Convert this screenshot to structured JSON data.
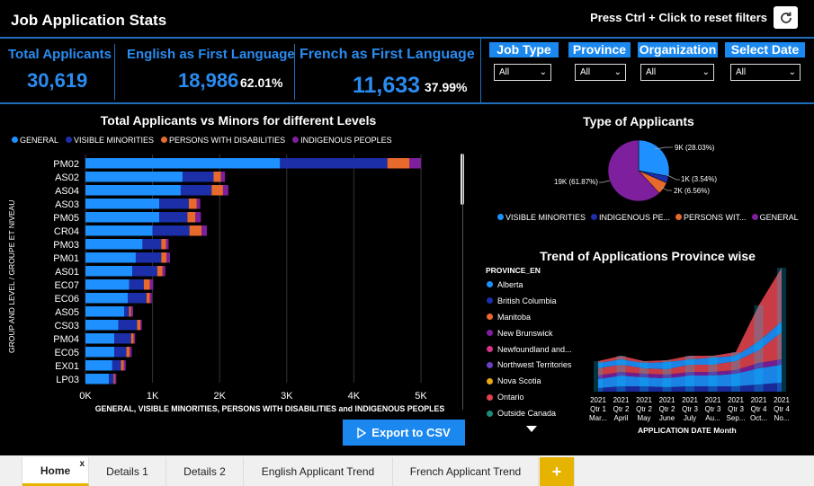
{
  "header": {
    "title": "Job Application Stats",
    "reset_hint": "Press Ctrl + Click to reset filters"
  },
  "kpis": {
    "total": {
      "title": "Total Applicants",
      "value": "30,619"
    },
    "english": {
      "title": "English as First Language",
      "value": "18,986",
      "pct": "62.01%"
    },
    "french": {
      "title": "French as First Language",
      "value": "11,633",
      "pct": "37.99%"
    }
  },
  "filters": [
    {
      "label": "Job Type",
      "value": "All"
    },
    {
      "label": "Province",
      "value": "All"
    },
    {
      "label": "Organization",
      "value": "All"
    },
    {
      "label": "Select Date",
      "value": "All"
    }
  ],
  "colors": {
    "general": "#1e90ff",
    "visible_minorities": "#1c2fa8",
    "disabilities": "#e8692c",
    "indigenous": "#7e1f9e",
    "accent": "#1b88f0"
  },
  "bar_chart": {
    "title": "Total Applicants vs Minors for different Levels",
    "ylabel": "GROUP AND LEVEL / GROUPE ET NIVEAU",
    "xlabel": "GENERAL, VISIBLE MINORITIES, PERSONS WITH DISABILITIES and INDIGENOUS PEOPLES",
    "legend": [
      "GENERAL",
      "VISIBLE MINORITIES",
      "PERSONS WITH DISABILITIES",
      "INDIGENOUS PEOPLES"
    ],
    "xticks": [
      "0K",
      "1K",
      "2K",
      "3K",
      "4K",
      "5K"
    ]
  },
  "pie_chart": {
    "title": "Type of Applicants",
    "legend": [
      "VISIBLE MINORITIES",
      "INDIGENOUS PE...",
      "PERSONS WIT...",
      "GENERAL"
    ],
    "labels": [
      "9K (28.03%)",
      "1K (3.54%)",
      "2K (6.56%)",
      "19K (61.87%)"
    ]
  },
  "trend_chart": {
    "title": "Trend of Applications Province wise",
    "legend_title": "PROVINCE_EN",
    "provinces": [
      {
        "name": "Alberta",
        "color": "#1e90ff"
      },
      {
        "name": "British Columbia",
        "color": "#1c2fa8"
      },
      {
        "name": "Manitoba",
        "color": "#e8692c"
      },
      {
        "name": "New Brunswick",
        "color": "#7e1f9e"
      },
      {
        "name": "Newfoundland and...",
        "color": "#d6338a"
      },
      {
        "name": "Northwest Territories",
        "color": "#6a3fc4"
      },
      {
        "name": "Nova Scotia",
        "color": "#e6a817"
      },
      {
        "name": "Ontario",
        "color": "#e0424c"
      },
      {
        "name": "Outside Canada",
        "color": "#1f8a7a"
      }
    ],
    "x_labels": [
      [
        "2021",
        "Qtr 1",
        "Mar..."
      ],
      [
        "2021",
        "Qtr 2",
        "April"
      ],
      [
        "2021",
        "Qtr 2",
        "May"
      ],
      [
        "2021",
        "Qtr 2",
        "June"
      ],
      [
        "2021",
        "Qtr 3",
        "July"
      ],
      [
        "2021",
        "Qtr 3",
        "Au..."
      ],
      [
        "2021",
        "Qtr 3",
        "Sep..."
      ],
      [
        "2021",
        "Qtr 4",
        "Oct..."
      ],
      [
        "2021",
        "Qtr 4",
        "No..."
      ]
    ],
    "xlabel": "APPLICATION DATE Month"
  },
  "chart_data": {
    "type": "bar",
    "orientation": "horizontal",
    "stacked": true,
    "categories": [
      "PM02",
      "AS02",
      "AS04",
      "AS03",
      "PM05",
      "CR04",
      "PM03",
      "PM01",
      "AS01",
      "EC07",
      "EC06",
      "AS05",
      "CS03",
      "PM04",
      "EC05",
      "EX01",
      "LP03"
    ],
    "series": [
      {
        "name": "GENERAL",
        "values": [
          2900,
          1450,
          1420,
          1100,
          1100,
          1000,
          850,
          750,
          700,
          650,
          630,
          580,
          490,
          430,
          430,
          400,
          350
        ]
      },
      {
        "name": "VISIBLE MINORITIES",
        "values": [
          1600,
          460,
          460,
          440,
          420,
          550,
          280,
          380,
          370,
          220,
          280,
          70,
          280,
          250,
          180,
          130,
          70
        ]
      },
      {
        "name": "PERSONS WITH DISABILITIES",
        "values": [
          330,
          110,
          170,
          120,
          120,
          180,
          70,
          80,
          80,
          90,
          50,
          30,
          50,
          40,
          50,
          40,
          20
        ]
      },
      {
        "name": "INDIGENOUS PEOPLES",
        "values": [
          170,
          60,
          80,
          50,
          80,
          80,
          40,
          50,
          40,
          50,
          30,
          30,
          20,
          20,
          30,
          30,
          20
        ]
      }
    ],
    "title": "Total Applicants vs Minors for different Levels",
    "xlabel": "GENERAL, VISIBLE MINORITIES, PERSONS WITH DISABILITIES and INDIGENOUS PEOPLES",
    "ylabel": "GROUP AND LEVEL / GROUPE ET NIVEAU",
    "xlim": [
      0,
      5000
    ],
    "legend_position": "top-left",
    "pie": {
      "title": "Type of Applicants",
      "slices": [
        {
          "name": "VISIBLE MINORITIES",
          "value": 28.03
        },
        {
          "name": "INDIGENOUS PEOPLES",
          "value": 3.54
        },
        {
          "name": "PERSONS WITH DISABILITIES",
          "value": 6.56
        },
        {
          "name": "GENERAL",
          "value": 61.87
        }
      ]
    }
  },
  "actions": {
    "export_label": "Export to CSV"
  },
  "tabs": [
    {
      "label": "Home"
    },
    {
      "label": "Details 1"
    },
    {
      "label": "Details 2"
    },
    {
      "label": "English Applicant Trend"
    },
    {
      "label": "French Applicant Trend"
    }
  ]
}
